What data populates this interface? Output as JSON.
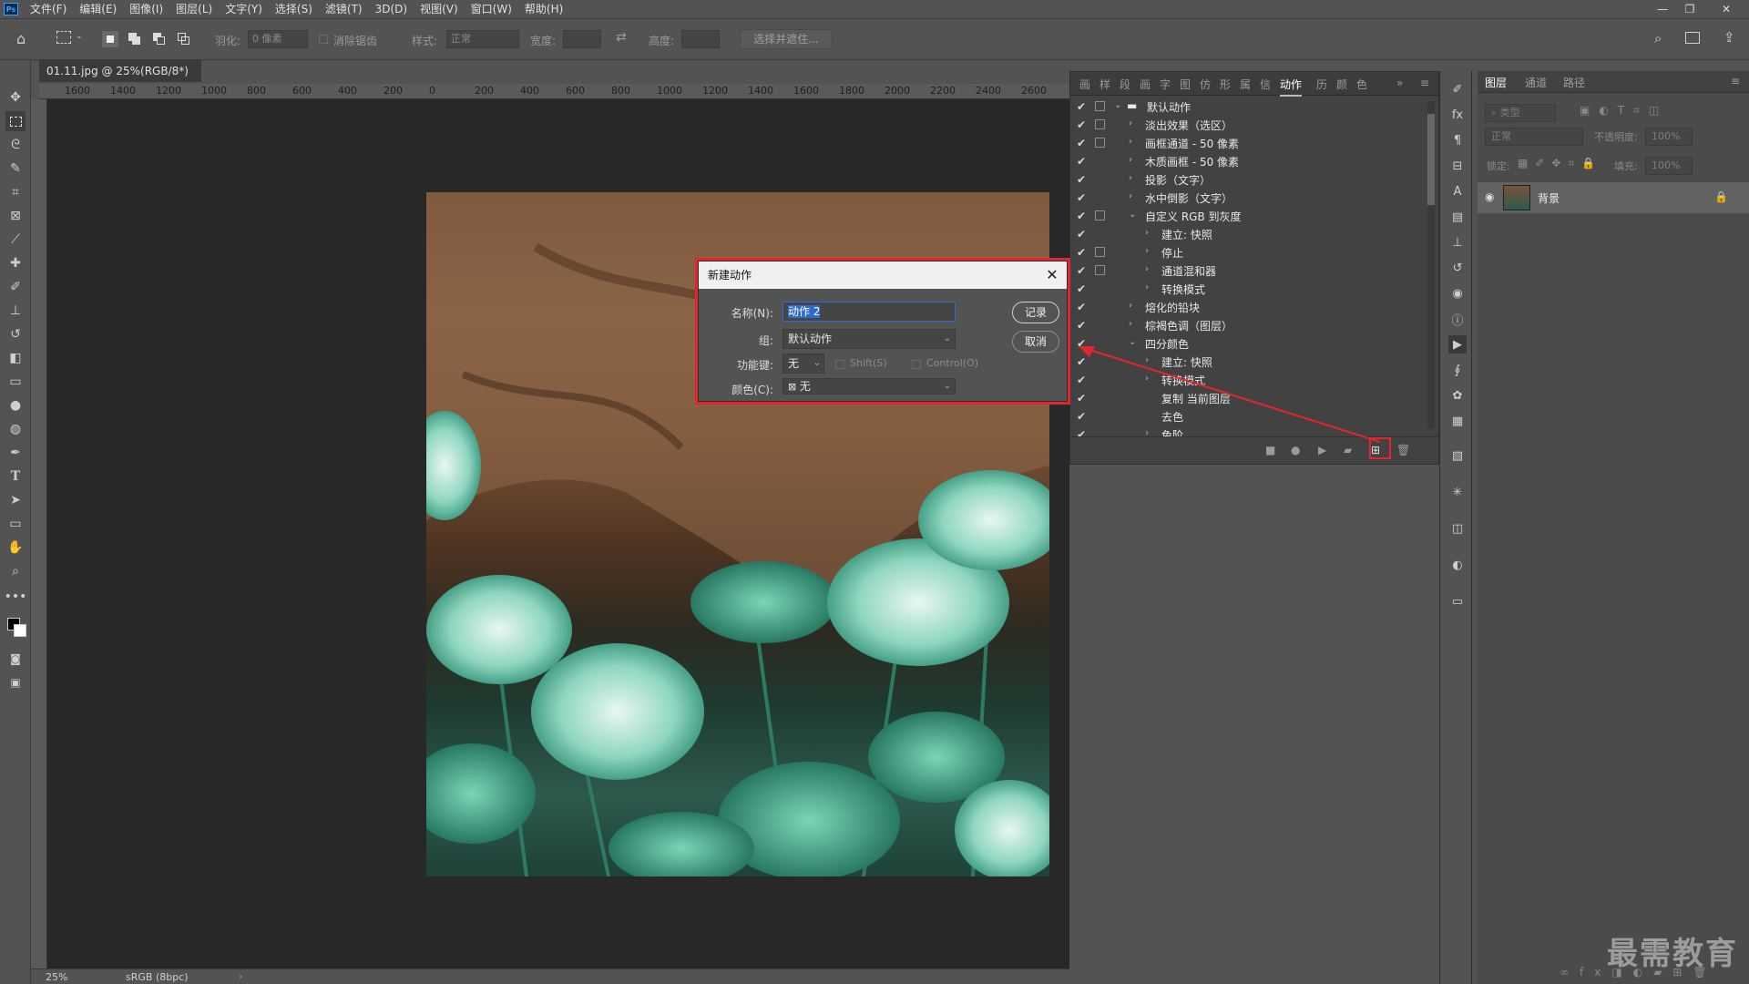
{
  "app": {
    "logo": "Ps",
    "menu": [
      "文件(F)",
      "编辑(E)",
      "图像(I)",
      "图层(L)",
      "文字(Y)",
      "选择(S)",
      "滤镜(T)",
      "3D(D)",
      "视图(V)",
      "窗口(W)",
      "帮助(H)"
    ]
  },
  "options_bar": {
    "feather_label": "羽化:",
    "feather_value": "0 像素",
    "antialias_label": "消除锯齿",
    "style_label": "样式:",
    "style_value": "正常",
    "width_label": "宽度:",
    "height_label": "高度:",
    "select_mask_button": "选择并遮住..."
  },
  "document": {
    "tab_title": "01.11.jpg @ 25%(RGB/8*)",
    "ruler_ticks": [
      "1600",
      "1400",
      "1200",
      "1000",
      "800",
      "600",
      "400",
      "200",
      "0",
      "200",
      "400",
      "600",
      "800",
      "1000",
      "1200",
      "1400",
      "1600",
      "1800",
      "2000",
      "2200",
      "2400",
      "2600"
    ],
    "zoom": "25%",
    "color_profile": "sRGB (8bpc)"
  },
  "actions_panel": {
    "active_tab": "动作",
    "tabs": [
      "画",
      "样",
      "段",
      "画",
      "字",
      "图",
      "仿",
      "形",
      "属",
      "信",
      "动作",
      "历",
      "颜",
      "色"
    ],
    "rows": [
      {
        "indent": 0,
        "expanded": true,
        "folder": true,
        "label": "默认动作",
        "check": true,
        "dialog": true
      },
      {
        "indent": 1,
        "expanded": false,
        "label": "淡出效果（选区）",
        "check": true,
        "dialog": true
      },
      {
        "indent": 1,
        "expanded": false,
        "label": "画框通道 - 50 像素",
        "check": true,
        "dialog": true
      },
      {
        "indent": 1,
        "expanded": false,
        "label": "木质画框 - 50 像素",
        "check": true,
        "dialog": false
      },
      {
        "indent": 1,
        "expanded": false,
        "label": "投影（文字）",
        "check": true,
        "dialog": false
      },
      {
        "indent": 1,
        "expanded": false,
        "label": "水中倒影（文字）",
        "check": true,
        "dialog": false
      },
      {
        "indent": 1,
        "expanded": true,
        "label": "自定义 RGB 到灰度",
        "check": true,
        "dialog": true
      },
      {
        "indent": 2,
        "expanded": false,
        "label": "建立: 快照",
        "check": true,
        "dialog": false
      },
      {
        "indent": 2,
        "expanded": false,
        "label": "停止",
        "check": true,
        "dialog": true
      },
      {
        "indent": 2,
        "expanded": false,
        "label": "通道混和器",
        "check": true,
        "dialog": true
      },
      {
        "indent": 2,
        "expanded": false,
        "label": "转换模式",
        "check": true,
        "dialog": false
      },
      {
        "indent": 1,
        "expanded": false,
        "label": "熔化的铅块",
        "check": true,
        "dialog": false
      },
      {
        "indent": 1,
        "expanded": false,
        "label": "棕褐色调（图层）",
        "check": true,
        "dialog": false
      },
      {
        "indent": 1,
        "expanded": true,
        "label": "四分颜色",
        "check": true,
        "dialog": false
      },
      {
        "indent": 2,
        "expanded": false,
        "label": "建立: 快照",
        "check": true,
        "dialog": false
      },
      {
        "indent": 2,
        "expanded": false,
        "label": "转换模式",
        "check": true,
        "dialog": false
      },
      {
        "indent": 2,
        "label": "复制 当前图层",
        "check": true,
        "dialog": false
      },
      {
        "indent": 2,
        "label": "去色",
        "check": true,
        "dialog": false
      },
      {
        "indent": 2,
        "expanded": false,
        "label": "色阶",
        "check": true,
        "dialog": false
      }
    ]
  },
  "layers_panel": {
    "tabs": [
      "图层",
      "通道",
      "路径"
    ],
    "filter_placeholder": "类型",
    "blend_mode": "正常",
    "opacity_label": "不透明度:",
    "opacity_value": "100%",
    "lock_label": "锁定:",
    "fill_label": "填充:",
    "fill_value": "100%",
    "layers": [
      {
        "name": "背景",
        "visible": true,
        "locked": true
      }
    ]
  },
  "dialog": {
    "title": "新建动作",
    "name_label": "名称(N):",
    "name_value": "动作 2",
    "set_label": "组:",
    "set_value": "默认动作",
    "fkey_label": "功能键:",
    "fkey_value": "无",
    "shift_label": "Shift(S)",
    "control_label": "Control(O)",
    "color_label": "颜色(C):",
    "color_value": "无",
    "record_button": "记录",
    "cancel_button": "取消"
  },
  "watermark": "最需教育",
  "colors": {
    "highlight": "#e3262d",
    "selection": "#2d6ccf"
  }
}
